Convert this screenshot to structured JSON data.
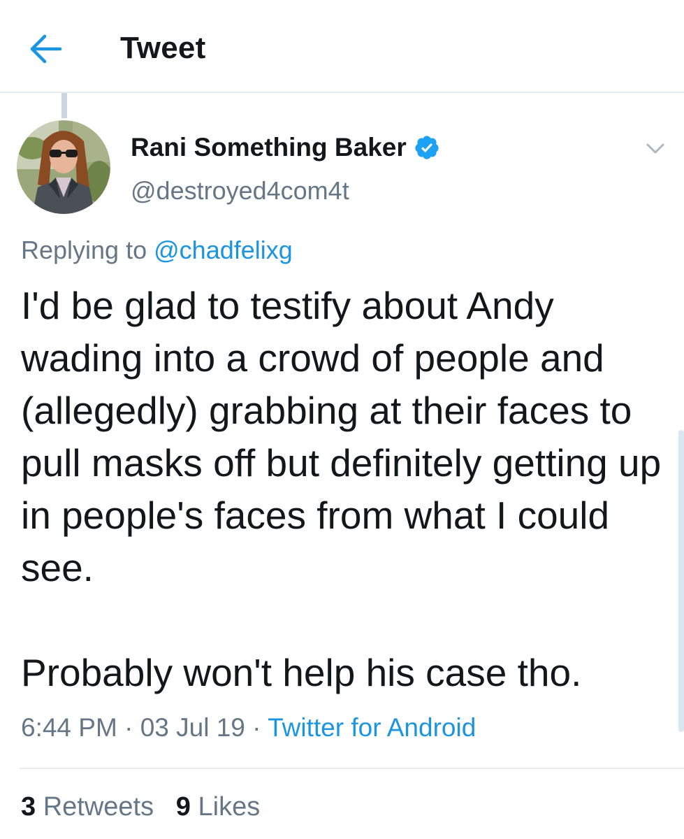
{
  "header": {
    "title": "Tweet",
    "back_icon": "arrow-left-icon"
  },
  "author": {
    "display_name": "Rani Something Baker",
    "handle": "@destroyed4com4t",
    "verified_icon": "verified-badge-icon",
    "menu_icon": "chevron-down-icon"
  },
  "reply": {
    "prefix": "Replying to",
    "mention": "@chadfelixg"
  },
  "tweet": {
    "paragraph_1": "I'd be glad to testify about Andy wading into a crowd of people and (allegedly) grabbing at their faces to pull masks off but definitely getting up in people's faces from what I could see.",
    "paragraph_2": "Probably won't help his case tho."
  },
  "meta": {
    "time": "6:44 PM",
    "separator": "·",
    "date": "03 Jul 19",
    "source": "Twitter for Android"
  },
  "stats": {
    "retweets_count": "3",
    "retweets_label": "Retweets",
    "likes_count": "9",
    "likes_label": "Likes"
  },
  "colors": {
    "accent": "#1b95e0",
    "secondary_text": "#657786",
    "primary_text": "#14171a",
    "divider": "#e6ecf0"
  }
}
